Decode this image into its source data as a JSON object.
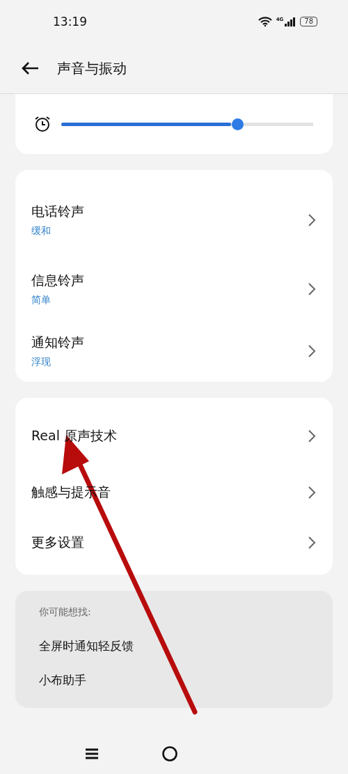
{
  "status_bar": {
    "time": "13:19",
    "network": "4G",
    "battery": "78"
  },
  "header": {
    "title": "声音与振动"
  },
  "alarm_volume": {
    "level": 0.7
  },
  "ringtones": [
    {
      "title": "电话铃声",
      "value": "缓和"
    },
    {
      "title": "信息铃声",
      "value": "简单"
    },
    {
      "title": "通知铃声",
      "value": "浮现"
    }
  ],
  "settings": [
    {
      "title": "Real 原声技术"
    },
    {
      "title": "触感与提示音"
    },
    {
      "title": "更多设置"
    }
  ],
  "suggestions": {
    "heading": "你可能想找:",
    "items": [
      "全屏时通知轻反馈",
      "小布助手"
    ]
  },
  "annotation": {
    "kind": "arrow"
  }
}
